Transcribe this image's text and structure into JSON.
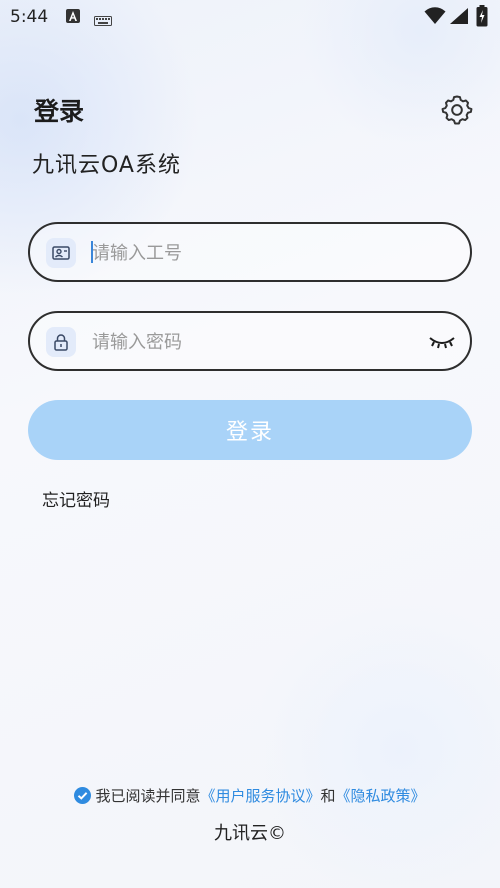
{
  "status_bar": {
    "time": "5:44",
    "icons": [
      "text-a-icon",
      "keyboard-icon",
      "wifi-icon",
      "signal-icon",
      "battery-charging-icon"
    ]
  },
  "header": {
    "title": "登录",
    "subtitle": "九讯云OA系统"
  },
  "form": {
    "employee_id": {
      "placeholder": "请输入工号",
      "value": "",
      "icon": "user-card-icon"
    },
    "password": {
      "placeholder": "请输入密码",
      "value": "",
      "icon": "lock-icon",
      "toggle_icon": "eye-closed-icon"
    },
    "login_label": "登录",
    "forgot_label": "忘记密码"
  },
  "agreement": {
    "checked": true,
    "prefix": "我已阅读并同意",
    "user_agreement": "《用户服务协议》",
    "conjunction": "和",
    "privacy_policy": "《隐私政策》"
  },
  "footer": {
    "text": "九讯云©"
  },
  "colors": {
    "accent": "#2f8be0",
    "button": "#a9d3f8",
    "field_border": "#2e2e2e"
  }
}
